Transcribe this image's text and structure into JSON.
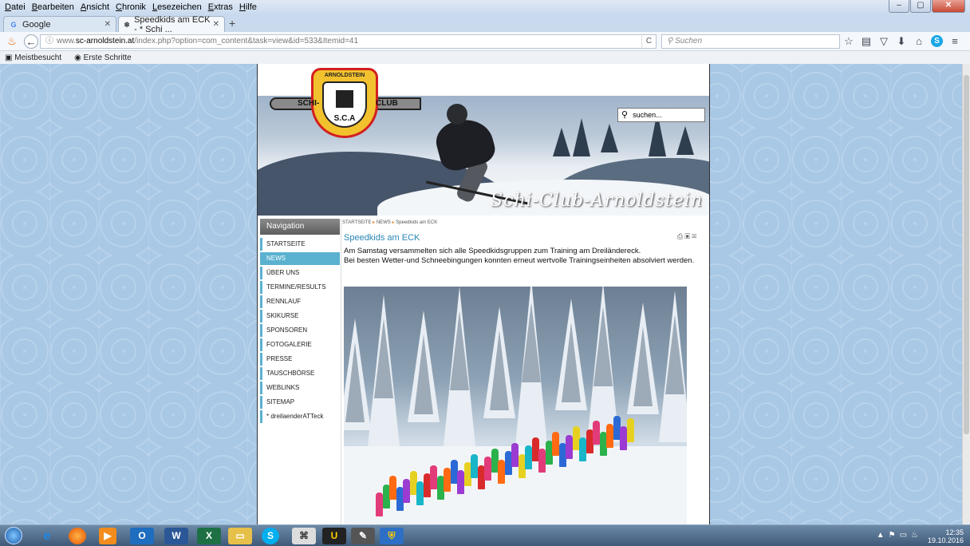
{
  "browser": {
    "menu": [
      "Datei",
      "Bearbeiten",
      "Ansicht",
      "Chronik",
      "Lesezeichen",
      "Extras",
      "Hilfe"
    ],
    "tabs": [
      {
        "label": "Google",
        "favicon": "G"
      },
      {
        "label": "Speedkids am ECK - * Schi ...",
        "favicon": "❄"
      }
    ],
    "url": {
      "prefix": "www.",
      "domain": "sc-arnoldstein.at",
      "path": "/index.php?option=com_content&task=view&id=533&Itemid=41"
    },
    "search_placeholder": "Suchen",
    "bookmarks": [
      "Meistbesucht",
      "Erste Schritte"
    ]
  },
  "site": {
    "logo": {
      "arc": "ARNOLDSTEIN",
      "left": "SCHI-",
      "right": "CLUB",
      "bottom": "S.C.A"
    },
    "banner_script": "Schi-Club-Arnoldstein",
    "search_placeholder": "suchen..."
  },
  "navigation": {
    "title": "Navigation",
    "items": [
      {
        "label": "STARTSEITE",
        "active": false
      },
      {
        "label": "NEWS",
        "active": true
      },
      {
        "label": "ÜBER UNS",
        "active": false
      },
      {
        "label": "TERMINE/RESULTS",
        "active": false
      },
      {
        "label": "RENNLAUF",
        "active": false
      },
      {
        "label": "SKIKURSE",
        "active": false
      },
      {
        "label": "SPONSOREN",
        "active": false
      },
      {
        "label": "FOTOGALERIE",
        "active": false
      },
      {
        "label": "PRESSE",
        "active": false
      },
      {
        "label": "TAUSCHBÖRSE",
        "active": false
      },
      {
        "label": "WEBLINKS",
        "active": false
      },
      {
        "label": "SITEMAP",
        "active": false
      },
      {
        "label": "* dreilaenderATTeck",
        "active": false
      }
    ]
  },
  "breadcrumb": [
    "STARTSEITE",
    "NEWS",
    "Speedkids am ECK"
  ],
  "article": {
    "title": "Speedkids am ECK",
    "line1": "Am Samstag versammelten sich alle Speedkidsgruppen zum Training am Dreiländereck.",
    "line2": "Bei besten Wetter-und Schneebingungen konnten erneut wertvolle Trainingseinheiten absolviert werden."
  },
  "taskbar": {
    "time": "12:35",
    "date": "19.10.2016"
  },
  "colors": {
    "accent": "#5ab1d0",
    "link": "#2a86b4",
    "breadcrumb_arrow": "#e67c14"
  }
}
